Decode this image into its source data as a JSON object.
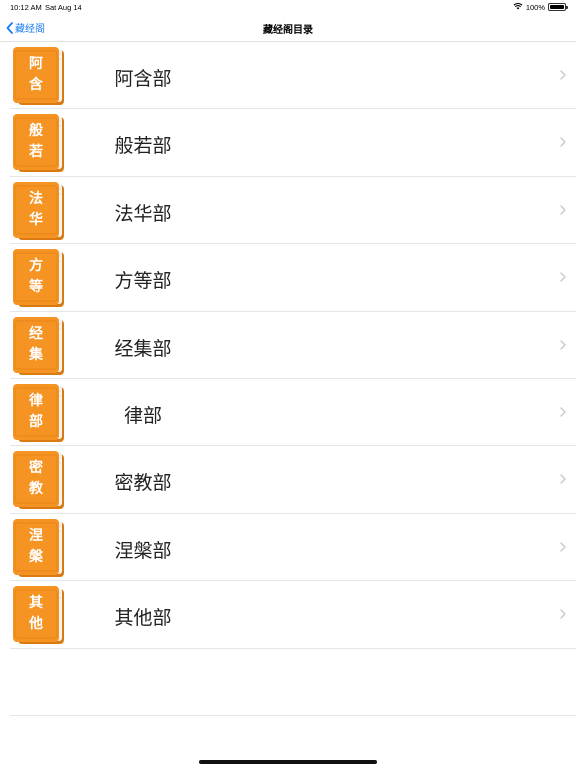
{
  "status_bar": {
    "time": "10:12 AM",
    "date": "Sat Aug 14",
    "battery": "100%",
    "battery_level": 1.0,
    "wifi_icon": "wifi-icon"
  },
  "nav": {
    "back_label": "藏经阁",
    "title": "藏经阁目录"
  },
  "colors": {
    "accent": "#1a7cf0",
    "book_orange": "#f59323",
    "book_dark": "#d97a12"
  },
  "sections": [
    {
      "label": "阿含部",
      "cover": [
        "阿",
        "含"
      ]
    },
    {
      "label": "般若部",
      "cover": [
        "般",
        "若"
      ]
    },
    {
      "label": "法华部",
      "cover": [
        "法",
        "华"
      ]
    },
    {
      "label": "方等部",
      "cover": [
        "方",
        "等"
      ]
    },
    {
      "label": "经集部",
      "cover": [
        "经",
        "集"
      ]
    },
    {
      "label": "律部",
      "cover": [
        "律",
        "部"
      ]
    },
    {
      "label": "密教部",
      "cover": [
        "密",
        "教"
      ]
    },
    {
      "label": "涅槃部",
      "cover": [
        "涅",
        "槃"
      ]
    },
    {
      "label": "其他部",
      "cover": [
        "其",
        "他"
      ]
    }
  ]
}
